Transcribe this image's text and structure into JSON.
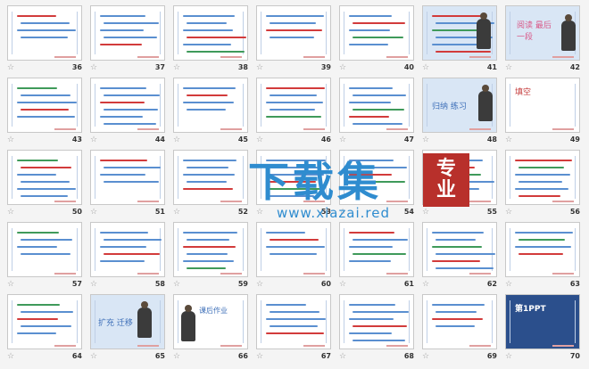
{
  "view": "slide-sorter",
  "slides": [
    {
      "num": "36",
      "title": ""
    },
    {
      "num": "37",
      "title": ""
    },
    {
      "num": "38",
      "title": ""
    },
    {
      "num": "39",
      "title": ""
    },
    {
      "num": "40",
      "title": ""
    },
    {
      "num": "41",
      "title": ""
    },
    {
      "num": "42",
      "title": "阅读 最后一段"
    },
    {
      "num": "43",
      "title": ""
    },
    {
      "num": "44",
      "title": ""
    },
    {
      "num": "45",
      "title": ""
    },
    {
      "num": "46",
      "title": ""
    },
    {
      "num": "47",
      "title": ""
    },
    {
      "num": "48",
      "title": "归纳 练习"
    },
    {
      "num": "49",
      "title": "填空"
    },
    {
      "num": "50",
      "title": ""
    },
    {
      "num": "51",
      "title": ""
    },
    {
      "num": "52",
      "title": ""
    },
    {
      "num": "53",
      "title": ""
    },
    {
      "num": "54",
      "title": ""
    },
    {
      "num": "55",
      "title": ""
    },
    {
      "num": "56",
      "title": ""
    },
    {
      "num": "57",
      "title": ""
    },
    {
      "num": "58",
      "title": ""
    },
    {
      "num": "59",
      "title": ""
    },
    {
      "num": "60",
      "title": ""
    },
    {
      "num": "61",
      "title": ""
    },
    {
      "num": "62",
      "title": ""
    },
    {
      "num": "63",
      "title": ""
    },
    {
      "num": "64",
      "title": ""
    },
    {
      "num": "65",
      "title": "扩充 迁移"
    },
    {
      "num": "66",
      "title": "课后作业"
    },
    {
      "num": "67",
      "title": ""
    },
    {
      "num": "68",
      "title": ""
    },
    {
      "num": "69",
      "title": ""
    },
    {
      "num": "70",
      "title": "第1PPT"
    }
  ],
  "watermark": {
    "main": "下载集",
    "badge_line1": "专",
    "badge_line2": "业",
    "url": "www.xiazai.red"
  },
  "colors": {
    "accent": "#2f8ccf",
    "badge": "#b8302b",
    "text_blue": "#3d6fb8"
  }
}
